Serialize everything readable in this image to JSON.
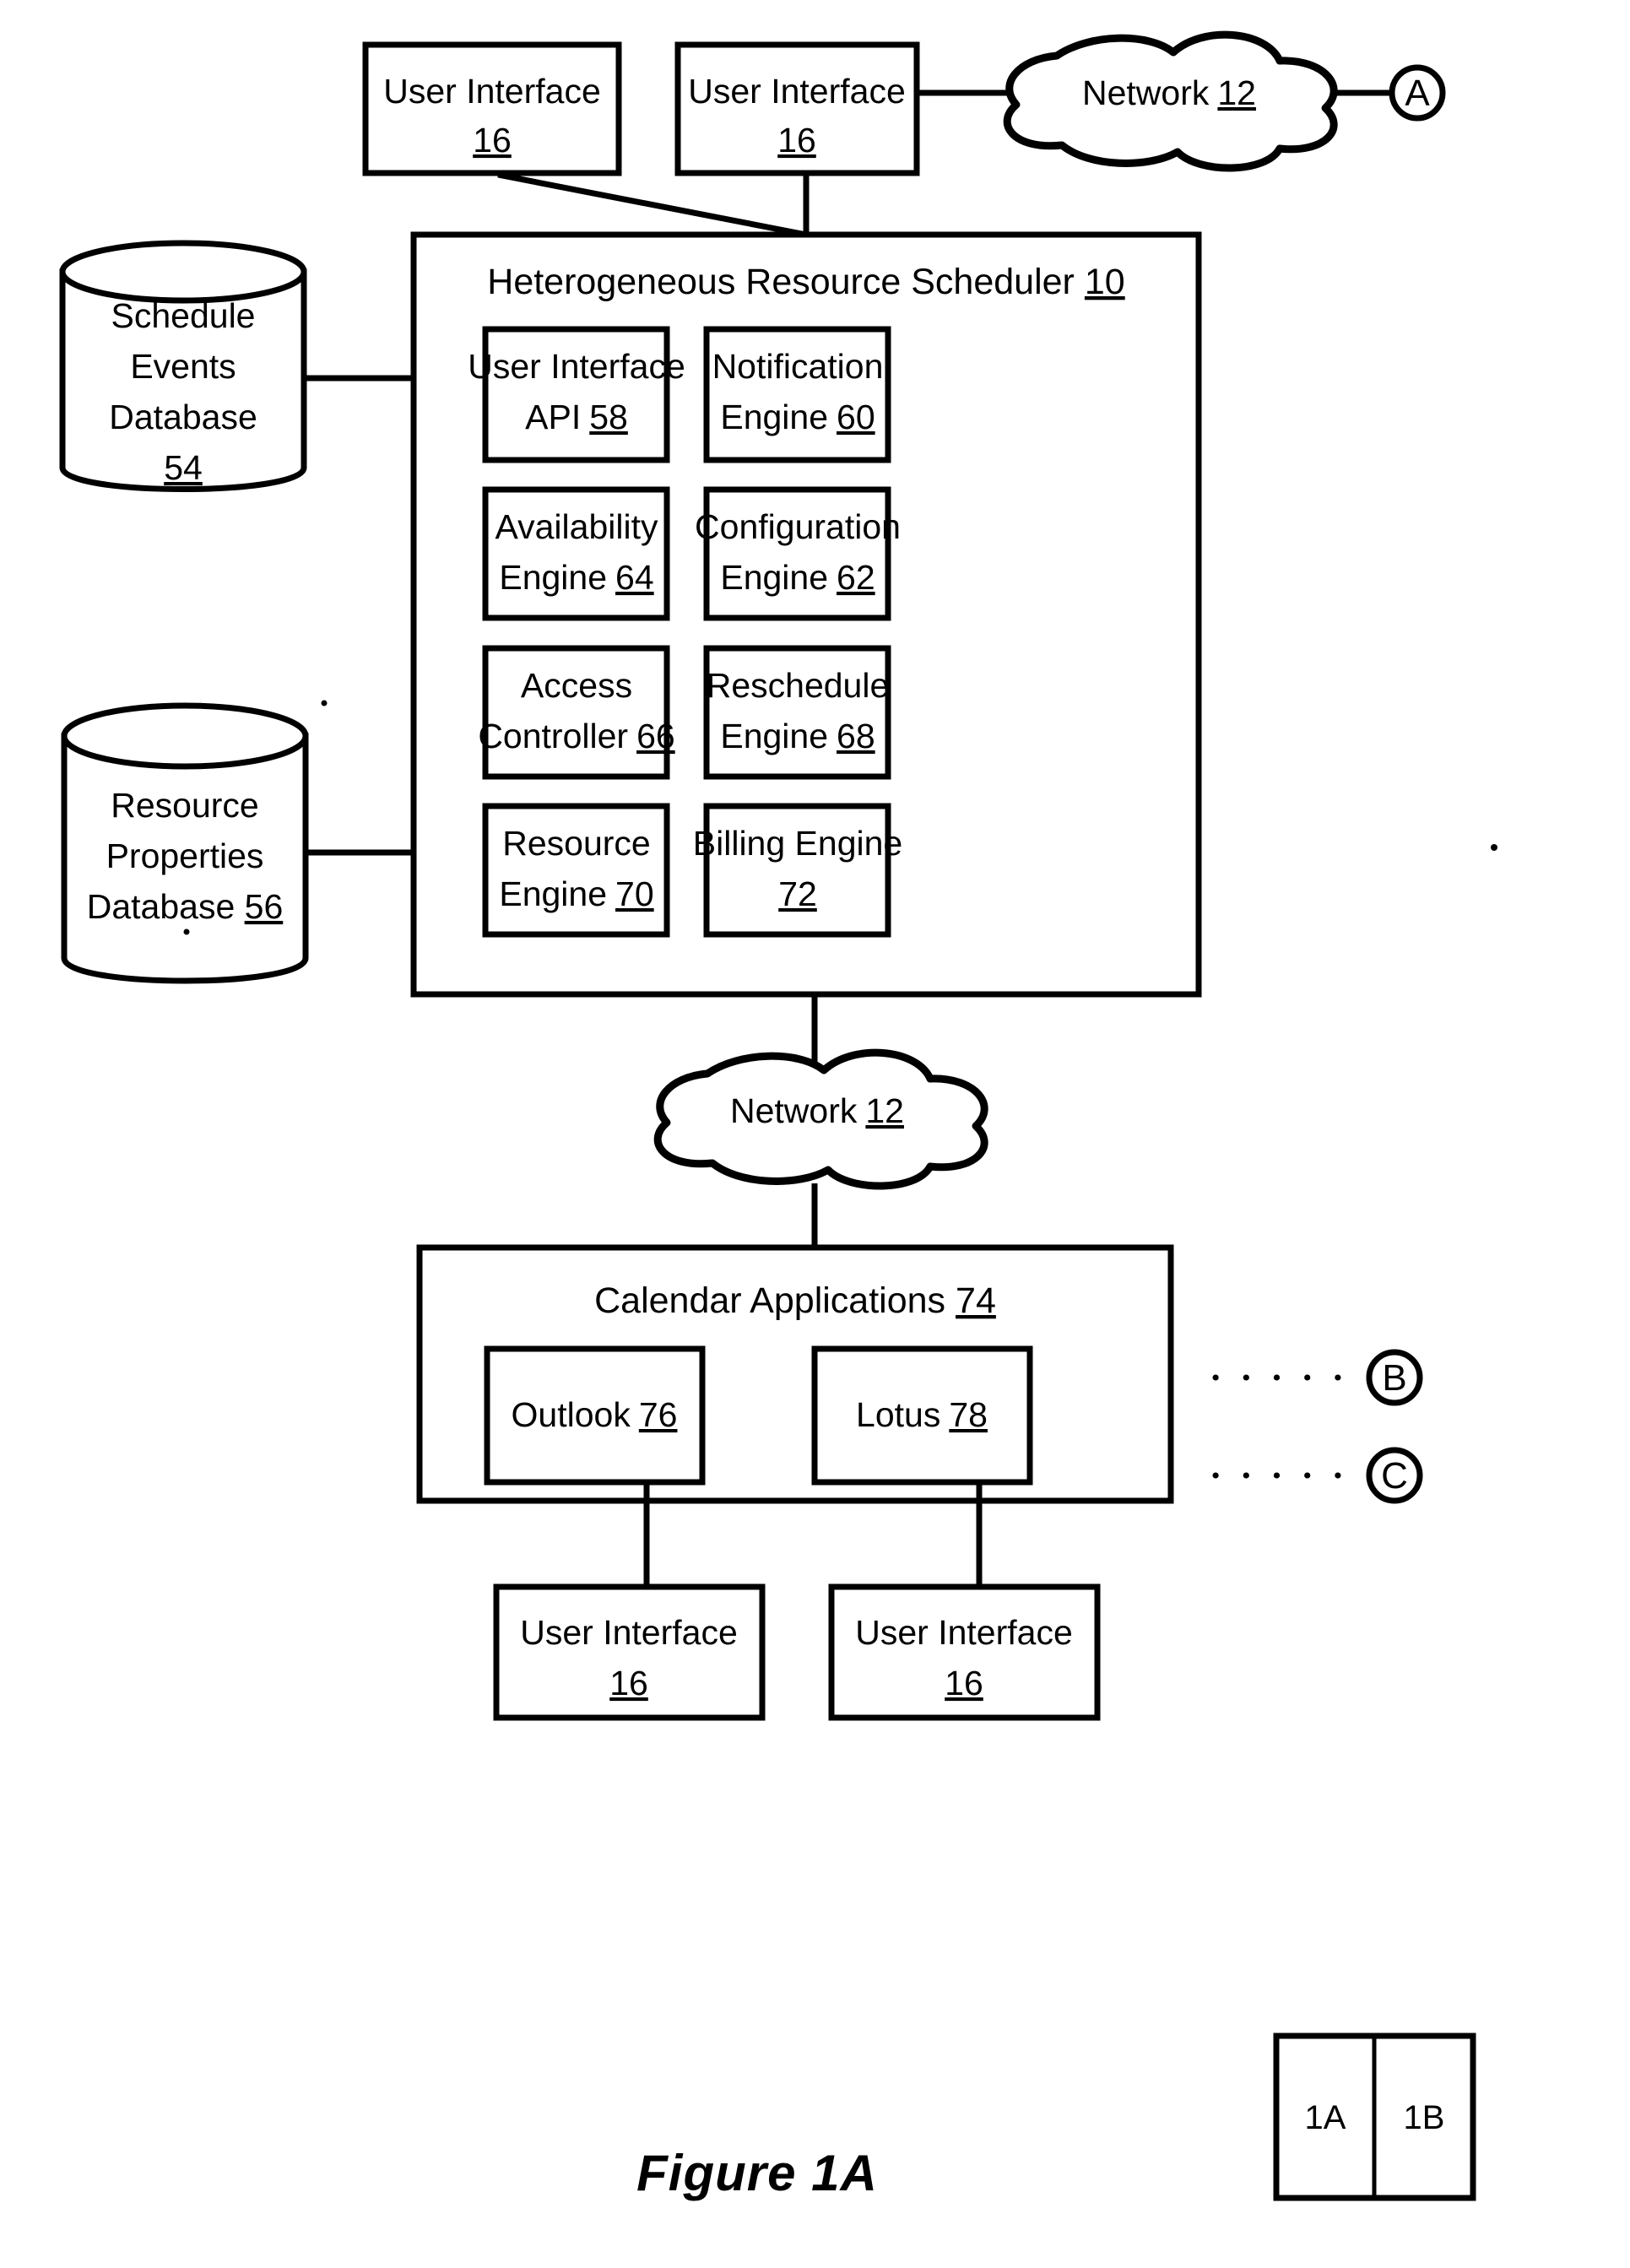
{
  "figure": {
    "caption": "Figure 1A"
  },
  "top_row": {
    "ui_left": {
      "line1": "User Interface",
      "ref": "16"
    },
    "ui_right": {
      "line1": "User Interface",
      "ref": "16"
    },
    "network": {
      "label": "Network",
      "ref": "12"
    },
    "connector_a": "A"
  },
  "databases": [
    {
      "lines": [
        "Schedule",
        "Events",
        "Database"
      ],
      "ref": "54"
    },
    {
      "lines": [
        "Resource",
        "Properties",
        "Database 56"
      ],
      "ref": ""
    }
  ],
  "scheduler": {
    "title": "Heterogeneous Resource  Scheduler",
    "title_ref": "10",
    "modules": [
      {
        "line1": "User Interface",
        "line2": "API",
        "ref": "58"
      },
      {
        "line1": "Notification",
        "line2": "Engine",
        "ref": "60"
      },
      {
        "line1": "Availability",
        "line2": "Engine",
        "ref": "64"
      },
      {
        "line1": "Configuration",
        "line2": "Engine",
        "ref": "62"
      },
      {
        "line1": "Access",
        "line2": "Controller",
        "ref": "66"
      },
      {
        "line1": "Reschedule",
        "line2": "Engine",
        "ref": "68"
      },
      {
        "line1": "Resource",
        "line2": "Engine",
        "ref": "70"
      },
      {
        "line1": "Billing Engine",
        "line2": "",
        "ref": "72"
      }
    ]
  },
  "mid_network": {
    "label": "Network",
    "ref": "12"
  },
  "calendar": {
    "title": "Calendar Applications",
    "title_ref": "74",
    "apps": [
      {
        "label": "Outlook",
        "ref": "76"
      },
      {
        "label": "Lotus",
        "ref": "78"
      }
    ],
    "connector_b": "B",
    "connector_c": "C"
  },
  "bottom_row": [
    {
      "line1": "User Interface",
      "ref": "16"
    },
    {
      "line1": "User Interface",
      "ref": "16"
    }
  ],
  "sheet_key": {
    "left": "1A",
    "right": "1B"
  },
  "colors": {
    "ink": "#000000",
    "paper": "#ffffff"
  }
}
